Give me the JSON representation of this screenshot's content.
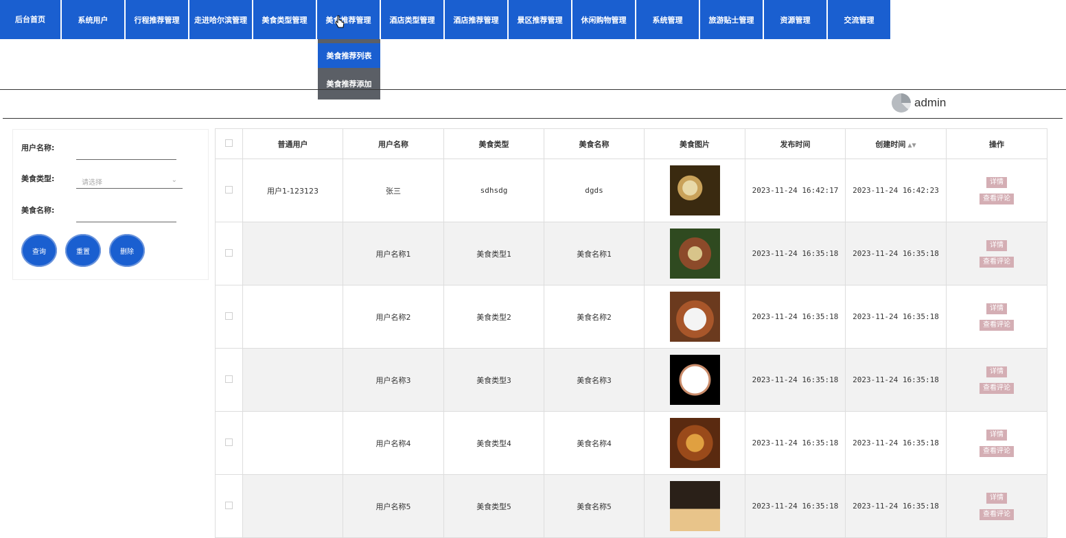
{
  "nav": {
    "items": [
      "后台首页",
      "系统用户",
      "行程推荐管理",
      "走进哈尔滨管理",
      "美食类型管理",
      "美食推荐管理",
      "酒店类型管理",
      "酒店推荐管理",
      "景区推荐管理",
      "休闲购物管理",
      "系统管理",
      "旅游贴士管理",
      "资源管理",
      "交流管理"
    ],
    "dropdown": [
      "美食推荐列表",
      "美食推荐添加"
    ]
  },
  "user": {
    "name": "admin"
  },
  "search": {
    "user_name_label": "用户名称:",
    "food_type_label": "美食类型:",
    "food_type_placeholder": "请选择",
    "food_name_label": "美食名称:",
    "query_label": "查询",
    "reset_label": "重置",
    "delete_label": "删除"
  },
  "table": {
    "headers": [
      "普通用户",
      "用户名称",
      "美食类型",
      "美食名称",
      "美食图片",
      "发布时间",
      "创建时间",
      "操作"
    ],
    "detail_label": "详情",
    "comment_label": "查看评论",
    "rows": [
      {
        "user": "用户1-123123",
        "name": "张三",
        "type": "sdhsdg",
        "food": "dgds",
        "publish": "2023-11-24 16:42:17",
        "created": "2023-11-24 16:42:23"
      },
      {
        "user": "",
        "name": "用户名称1",
        "type": "美食类型1",
        "food": "美食名称1",
        "publish": "2023-11-24 16:35:18",
        "created": "2023-11-24 16:35:18"
      },
      {
        "user": "",
        "name": "用户名称2",
        "type": "美食类型2",
        "food": "美食名称2",
        "publish": "2023-11-24 16:35:18",
        "created": "2023-11-24 16:35:18"
      },
      {
        "user": "",
        "name": "用户名称3",
        "type": "美食类型3",
        "food": "美食名称3",
        "publish": "2023-11-24 16:35:18",
        "created": "2023-11-24 16:35:18"
      },
      {
        "user": "",
        "name": "用户名称4",
        "type": "美食类型4",
        "food": "美食名称4",
        "publish": "2023-11-24 16:35:18",
        "created": "2023-11-24 16:35:18"
      },
      {
        "user": "",
        "name": "用户名称5",
        "type": "美食类型5",
        "food": "美食名称5",
        "publish": "2023-11-24 16:35:18",
        "created": "2023-11-24 16:35:18"
      }
    ]
  },
  "colors": {
    "primary": "#1a5fd0",
    "dropdown_bg": "#5b5f66",
    "op_button": "#d4aeb4"
  }
}
